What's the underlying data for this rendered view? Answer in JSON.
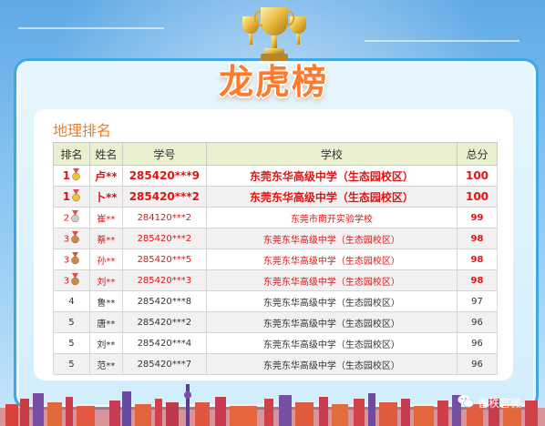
{
  "banner": {
    "title": "龙虎榜",
    "trophy_icon": "trophy-icon"
  },
  "section_title": "地理排名",
  "table": {
    "headers": [
      "排名",
      "姓名",
      "学号",
      "学校",
      "总分"
    ],
    "rows": [
      {
        "rank": "1",
        "name": "卢**",
        "id": "285420***9",
        "school": "东莞东华高级中学（生态园校区）",
        "score": "100",
        "medal": "gold"
      },
      {
        "rank": "1",
        "name": "卜**",
        "id": "285420***2",
        "school": "东莞东华高级中学（生态园校区）",
        "score": "100",
        "medal": "gold"
      },
      {
        "rank": "2",
        "name": "崔**",
        "id": "284120***2",
        "school": "东莞市南开实验学校",
        "score": "99",
        "medal": "silver"
      },
      {
        "rank": "3",
        "name": "蔡**",
        "id": "285420***2",
        "school": "东莞东华高级中学（生态园校区）",
        "score": "98",
        "medal": "bronze"
      },
      {
        "rank": "3",
        "name": "孙**",
        "id": "285420***5",
        "school": "东莞东华高级中学（生态园校区）",
        "score": "98",
        "medal": "bronze"
      },
      {
        "rank": "3",
        "name": "刘**",
        "id": "285420***3",
        "school": "东莞东华高级中学（生态园校区）",
        "score": "98",
        "medal": "bronze"
      },
      {
        "rank": "4",
        "name": "鲁**",
        "id": "285420***8",
        "school": "东莞东华高级中学（生态园校区）",
        "score": "97",
        "medal": ""
      },
      {
        "rank": "5",
        "name": "唐**",
        "id": "285420***2",
        "school": "东莞东华高级中学（生态园校区）",
        "score": "96",
        "medal": ""
      },
      {
        "rank": "5",
        "name": "刘**",
        "id": "285420***4",
        "school": "东莞东华高级中学（生态园校区）",
        "score": "96",
        "medal": ""
      },
      {
        "rank": "5",
        "name": "范**",
        "id": "285420***7",
        "school": "东莞东华高级中学（生态园校区）",
        "score": "96",
        "medal": ""
      }
    ]
  },
  "watermark": {
    "text": "香秩官微",
    "icon": "wechat-icon"
  },
  "colors": {
    "accent": "#ff7a2a",
    "highlight": "#e01414",
    "header_bg": "#e9f0cf",
    "frame": "#3fa6e8"
  }
}
